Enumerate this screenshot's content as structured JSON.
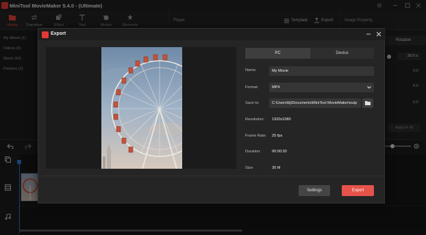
{
  "app": {
    "title": "MiniTool MovieMaker 5.4.0 - (Ultimate)"
  },
  "toolbar": {
    "items": [
      {
        "label": "Media",
        "icon": "folder-icon",
        "active": true
      },
      {
        "label": "Transition",
        "icon": "transition-icon",
        "active": false
      },
      {
        "label": "Effect",
        "icon": "effect-icon",
        "active": false
      },
      {
        "label": "Text",
        "icon": "text-icon",
        "active": false
      },
      {
        "label": "Motion",
        "icon": "motion-icon",
        "active": false
      },
      {
        "label": "Elements",
        "icon": "elements-icon",
        "active": false
      }
    ]
  },
  "player": {
    "label": "Player",
    "template_label": "Template",
    "export_label": "Export"
  },
  "property_panel": {
    "title": "Image Property",
    "tab_label": "Rotation",
    "rotation_value": "30.0 s",
    "values": [
      "0.0",
      "0.0",
      "0.0"
    ],
    "apply_all_label": "Apply to all"
  },
  "library": {
    "items": [
      "My Album (1)",
      "Videos (0)",
      "Music (52)",
      "Pictures (1)"
    ]
  },
  "export_dialog": {
    "title": "Export",
    "tabs": {
      "pc": "PC",
      "device": "Device"
    },
    "fields": {
      "name_label": "Name:",
      "name_value": "My Movie",
      "format_label": "Format:",
      "format_value": "MP4",
      "save_to_label": "Save to:",
      "save_to_value": "C:\\Users\\bj\\Documents\\MiniTool MovieMaker\\outp",
      "resolution_label": "Resolution:",
      "resolution_value": "1920x1080",
      "frame_rate_label": "Frame Rate:",
      "frame_rate_value": "25 fps",
      "duration_label": "Duration:",
      "duration_value": "00:00:30",
      "size_label": "Size:",
      "size_value": "30 M"
    },
    "settings_label": "Settings",
    "export_label": "Export"
  },
  "colors": {
    "accent": "#e5534b",
    "brand": "#e53935",
    "playhead": "#2f7bd6"
  }
}
